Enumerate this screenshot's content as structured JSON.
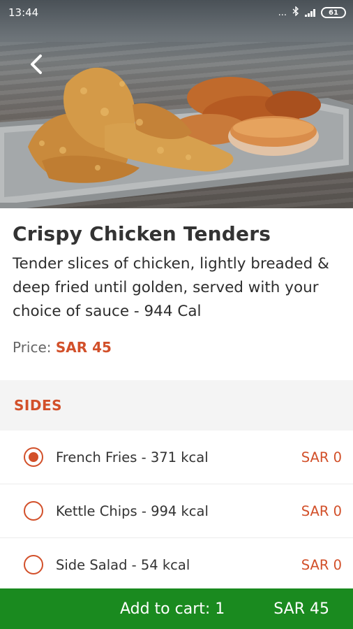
{
  "status_bar": {
    "time": "13:44",
    "dots": "...",
    "battery": "61"
  },
  "hero": {
    "image_subject": "crispy-chicken-tenders-photo"
  },
  "product": {
    "title": "Crispy Chicken Tenders",
    "description": "Tender slices of chicken, lightly breaded & deep fried until golden, served with your choice of sauce - 944 Cal",
    "price_label": "Price:",
    "price_value": "SAR 45"
  },
  "sides": {
    "header": "SIDES",
    "options": [
      {
        "label": "French Fries - 371 kcal",
        "price": "SAR 0",
        "selected": true
      },
      {
        "label": "Kettle Chips - 994 kcal",
        "price": "SAR 0",
        "selected": false
      },
      {
        "label": "Side Salad - 54 kcal",
        "price": "SAR 0",
        "selected": false
      }
    ]
  },
  "cart": {
    "label": "Add to cart: 1",
    "total": "SAR 45"
  },
  "colors": {
    "accent": "#d2502a",
    "cart_green": "#1a8a1f",
    "section_bg": "#f4f4f4"
  },
  "icons": {
    "back": "back-arrow-icon",
    "bluetooth": "bluetooth-icon",
    "signal": "signal-icon",
    "battery": "battery-icon"
  }
}
